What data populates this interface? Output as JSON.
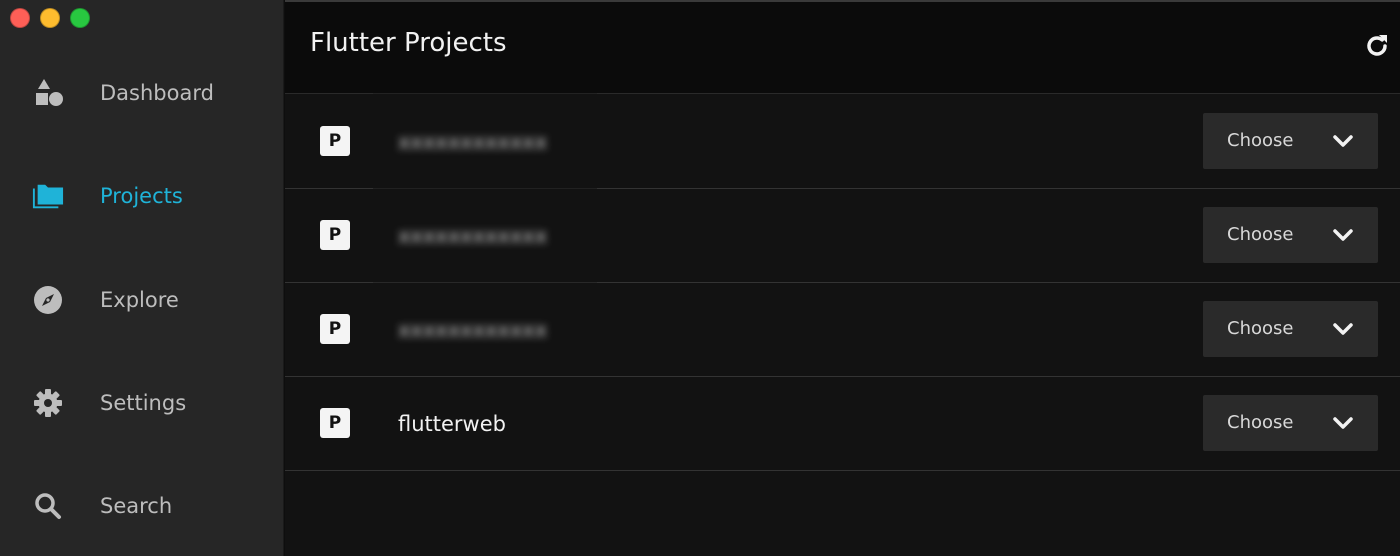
{
  "window": {
    "traffic_lights": {
      "close_color": "#fe5f57",
      "minimize_color": "#febc2e",
      "zoom_color": "#28c840"
    }
  },
  "sidebar": {
    "accent_color": "#1fb3d8",
    "items": [
      {
        "label": "Dashboard",
        "icon": "shapes-icon",
        "active": false
      },
      {
        "label": "Projects",
        "icon": "folders-icon",
        "active": true
      },
      {
        "label": "Explore",
        "icon": "compass-icon",
        "active": false
      },
      {
        "label": "Settings",
        "icon": "gear-icon",
        "active": false
      },
      {
        "label": "Search",
        "icon": "search-icon",
        "active": false
      }
    ]
  },
  "header": {
    "title": "Flutter Projects",
    "refresh_icon": "refresh-icon"
  },
  "projects": [
    {
      "badge": "P",
      "name": "xxxxxxxxxxxx",
      "redacted": true,
      "action_label": "Choose"
    },
    {
      "badge": "P",
      "name": "xxxxxxxxxxxx",
      "redacted": true,
      "action_label": "Choose"
    },
    {
      "badge": "P",
      "name": "xxxxxxxxxxxx",
      "redacted": true,
      "action_label": "Choose"
    },
    {
      "badge": "P",
      "name": "flutterweb",
      "redacted": false,
      "action_label": "Choose"
    }
  ]
}
